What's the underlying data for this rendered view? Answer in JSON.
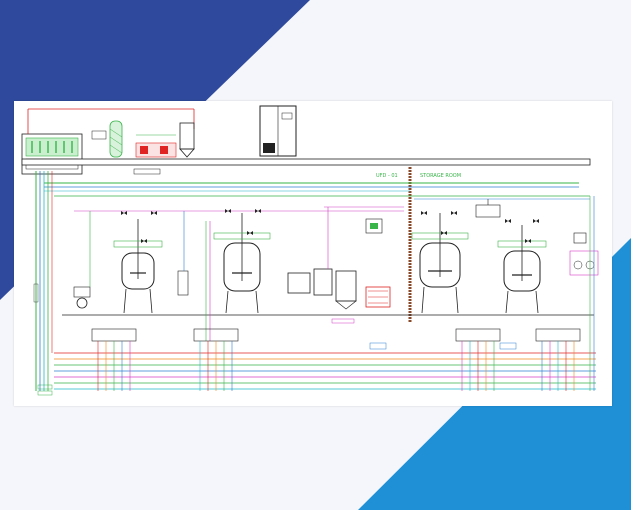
{
  "colors": {
    "corner_navy": "#2f4a9c",
    "corner_blue": "#1f8fd6",
    "page_background": "#f4f6fb",
    "drawing_background": "#ffffff",
    "pipe_green": "#39b54a",
    "pipe_blue": "#2e7fd1",
    "pipe_red": "#e02424",
    "pipe_magenta": "#d63cc8",
    "pipe_cyan": "#1fb6c9",
    "pipe_orange": "#f08a1c",
    "line_dark": "#222222",
    "divider_brown": "#8a4a2a"
  },
  "diagram": {
    "area_labels": {
      "ufd_01": "UFD - 01",
      "storage_room": "STORAGE ROOM"
    },
    "icons": [
      "reactor-tank-icon",
      "storage-tank-icon",
      "control-cabinet-icon",
      "column-icon",
      "silo-icon",
      "pump-icon",
      "valve-icon"
    ]
  }
}
